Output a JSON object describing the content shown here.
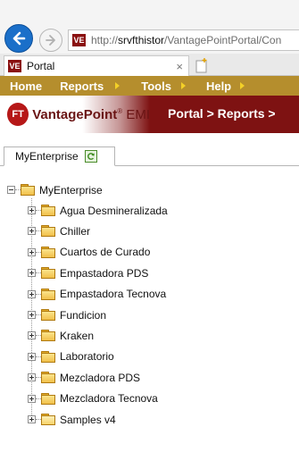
{
  "browser": {
    "url_prefix": "http://",
    "url_host": "srvfthistor",
    "url_path": "/VantagePointPortal/Con",
    "favicon_text": "VE",
    "tab_title": "Portal",
    "tab_close": "×"
  },
  "menu": {
    "items": [
      {
        "label": "Home",
        "has_arrow": false
      },
      {
        "label": "Reports",
        "has_arrow": true
      },
      {
        "label": "Tools",
        "has_arrow": true
      },
      {
        "label": "Help",
        "has_arrow": true
      }
    ]
  },
  "brand": {
    "badge": "FT",
    "name": "VantagePoint",
    "reg": "®",
    "suffix": " EMI",
    "breadcrumb": "Portal > Reports >"
  },
  "panel": {
    "tab_label": "MyEnterprise"
  },
  "tree": {
    "root": "MyEnterprise",
    "children": [
      "Agua Desmineralizada",
      "Chiller",
      "Cuartos de Curado",
      "Empastadora PDS",
      "Empastadora Tecnova",
      "Fundicion",
      "Kraken",
      "Laboratorio",
      "Mezcladora PDS",
      "Mezcladora Tecnova",
      "Samples v4"
    ]
  },
  "colors": {
    "menu_bar": "#b58e2d",
    "menu_arrow": "#f3d027",
    "brand_bar": "#7e1212",
    "back_button": "#1a6fc9"
  }
}
